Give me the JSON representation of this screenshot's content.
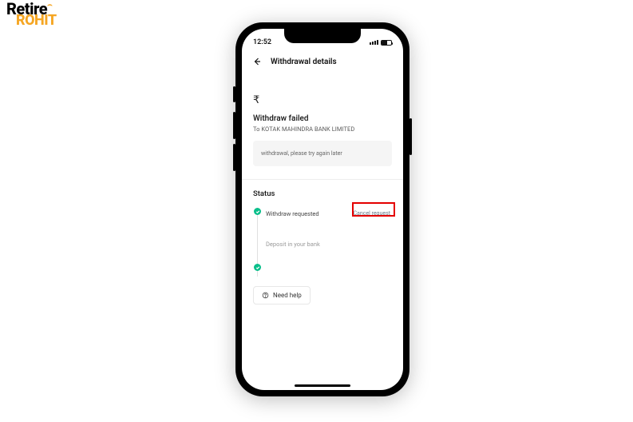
{
  "watermark": {
    "line1": "Retire",
    "line2": "ROHIT"
  },
  "statusbar": {
    "time": "12:52"
  },
  "header": {
    "title": "Withdrawal details"
  },
  "amount": {
    "symbol": "₹",
    "value": ""
  },
  "summary": {
    "title": "Withdraw failed",
    "to_line": "To KOTAK MAHINDRA BANK LIMITED"
  },
  "message_box": "withdrawal, please try again later",
  "status": {
    "heading": "Status",
    "steps": [
      {
        "label": "Withdraw requested",
        "done": true
      },
      {
        "label": "Deposit in your bank",
        "done": false
      }
    ],
    "cancel_label": "Cancel request"
  },
  "help": {
    "label": "Need help"
  }
}
